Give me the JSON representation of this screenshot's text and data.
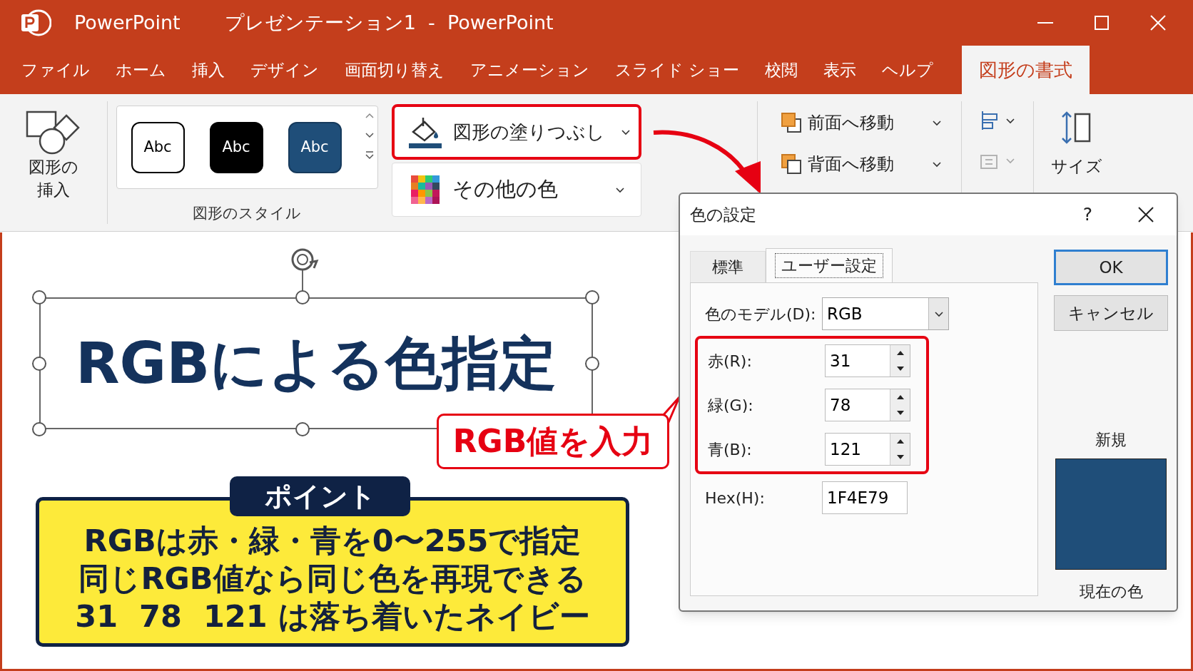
{
  "window": {
    "app_name": "PowerPoint",
    "title": "プレゼンテーション1  -  PowerPoint"
  },
  "menu_tabs": [
    {
      "label": "ファイル",
      "selected": false
    },
    {
      "label": "ホーム",
      "selected": false
    },
    {
      "label": "挿入",
      "selected": false
    },
    {
      "label": "デザイン",
      "selected": false
    },
    {
      "label": "画面切り替え",
      "selected": false
    },
    {
      "label": "アニメーション",
      "selected": false
    },
    {
      "label": "スライド ショー",
      "selected": false
    },
    {
      "label": "校閲",
      "selected": false
    },
    {
      "label": "表示",
      "selected": false
    },
    {
      "label": "ヘルプ",
      "selected": false
    },
    {
      "label": "図形の書式",
      "selected": true
    }
  ],
  "ribbon": {
    "insert_shape": {
      "lines": [
        "図形の",
        "挿入"
      ]
    },
    "shape_styles": {
      "group_label": "図形のスタイル",
      "samples": [
        {
          "label": "Abc",
          "kind": "outline"
        },
        {
          "label": "Abc",
          "kind": "black"
        },
        {
          "label": "Abc",
          "kind": "navy"
        }
      ]
    },
    "fill_button": {
      "label": "図形の塗りつぶし",
      "highlighted": true
    },
    "more_colors_button": {
      "label": "その他の色"
    },
    "arrange": [
      {
        "label": "前面へ移動",
        "kind": "front"
      },
      {
        "label": "背面へ移動",
        "kind": "back"
      }
    ],
    "size": {
      "label": "サイズ"
    }
  },
  "slide": {
    "title": "RGBによる色指定",
    "point": {
      "badge": "ポイント",
      "lines": [
        "RGBは赤・緑・青を0〜255で指定",
        "同じRGB値なら同じ色を再現できる",
        "31  78  121 は落ち着いたネイビー"
      ]
    }
  },
  "callout": {
    "text": "RGB値を入力"
  },
  "dialog": {
    "title": "色の設定",
    "help": "?",
    "tabs": [
      {
        "label": "標準",
        "selected": false
      },
      {
        "label": "ユーザー設定",
        "selected": true
      }
    ],
    "color_model": {
      "label": "色のモデル(D):",
      "value": "RGB"
    },
    "channels_highlighted": true,
    "channels": [
      {
        "label": "赤(R):",
        "value": "31"
      },
      {
        "label": "緑(G):",
        "value": "78"
      },
      {
        "label": "青(B):",
        "value": "121"
      }
    ],
    "hex": {
      "label": "Hex(H):",
      "value": "1F4E79"
    },
    "buttons": [
      {
        "label": "OK",
        "kind": "default"
      },
      {
        "label": "キャンセル",
        "kind": "normal"
      }
    ],
    "new_label": "新規",
    "current_label": "現在の色"
  }
}
